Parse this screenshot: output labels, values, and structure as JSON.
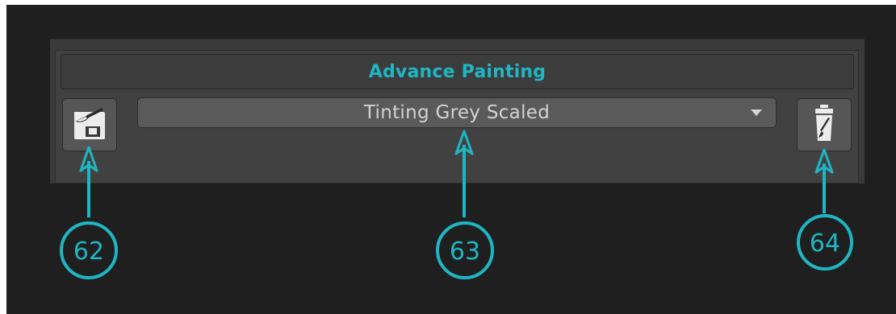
{
  "panel": {
    "title": "Advance Painting",
    "save_button": {
      "icon": "save-brush-icon"
    },
    "preset_dropdown": {
      "value": "Tinting Grey Scaled",
      "arrow_icon": "dropdown-arrow-icon"
    },
    "delete_button": {
      "icon": "trash-brush-icon"
    }
  },
  "callouts": [
    {
      "number": "62"
    },
    {
      "number": "63"
    },
    {
      "number": "64"
    }
  ],
  "colors": {
    "accent": "#1fb6c4",
    "background": "#1f1f1f",
    "panel": "#414141",
    "button": "#565656"
  }
}
